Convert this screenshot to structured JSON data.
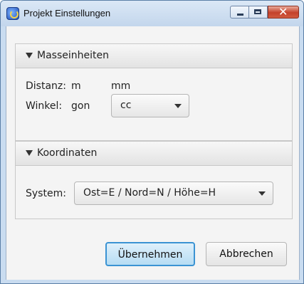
{
  "window": {
    "title": "Projekt Einstellungen"
  },
  "masseinheiten": {
    "header": "Masseinheiten",
    "distanz_label": "Distanz:",
    "distanz_value": "m",
    "distanz_unit2": "mm",
    "winkel_label": "Winkel:",
    "winkel_value": "gon",
    "winkel_select": "cc"
  },
  "koordinaten": {
    "header": "Koordinaten",
    "system_label": "System:",
    "system_select": "Ost=E / Nord=N / Höhe=H"
  },
  "buttons": {
    "apply": "Übernehmen",
    "cancel": "Abbrechen"
  },
  "colors": {
    "default_button_border": "#3b93d3",
    "close_button": "#c4412a"
  },
  "icons": {
    "app": "app-icon",
    "collapse": "triangle-down-icon",
    "dropdown": "chevron-down-icon"
  }
}
